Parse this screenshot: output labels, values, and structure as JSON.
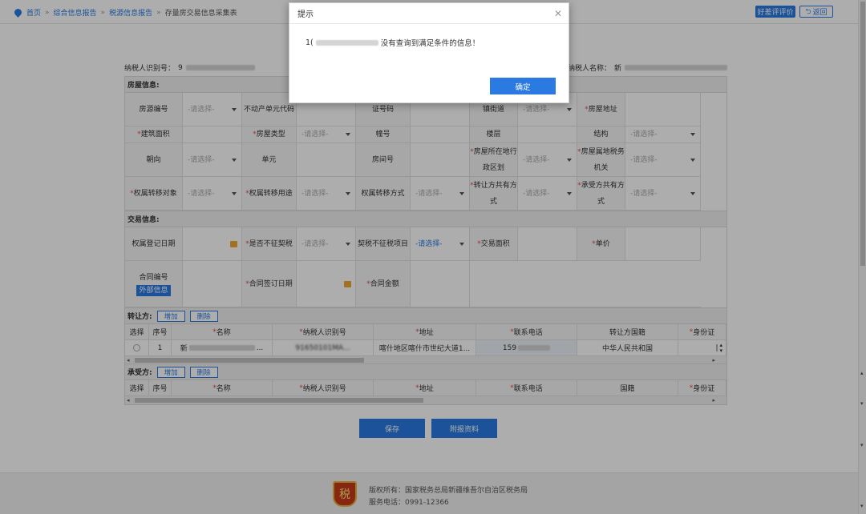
{
  "breadcrumb": [
    "首页",
    "综合信息报告",
    "税源信息报告",
    "存量房交易信息采集表"
  ],
  "top_buttons": {
    "evaluate": "好差评评价",
    "back": "返回"
  },
  "header_ids": {
    "taxpayer_id_label": "纳税人识别号：",
    "taxpayer_id_prefix": "9",
    "taxpayer_name_label": "纳税人名称：",
    "taxpayer_name_prefix": "新"
  },
  "house_section": {
    "title": "房屋信息:",
    "row1": {
      "c0": "房源编号",
      "c1": "-请选择-",
      "c2": "不动产单元代码",
      "c4": "证号码",
      "c6": "镇街道",
      "c7": "-请选择-",
      "c8": "房屋地址"
    },
    "row2": {
      "c0": "建筑面积",
      "c2": "房屋类型",
      "c3": "-请选择-",
      "c4": "幢号",
      "c6": "楼层",
      "c8": "结构",
      "c9": "-请选择-"
    },
    "row3": {
      "c0": "朝向",
      "c1": "-请选择-",
      "c2": "单元",
      "c4": "房间号",
      "c6": "房屋所在地行政区划",
      "c7": "-请选择-",
      "c8": "房屋属地税务机关",
      "c9": "-请选择-"
    },
    "row4": {
      "c0": "权属转移对象",
      "c1": "-请选择-",
      "c2": "权属转移用途",
      "c3": "-请选择-",
      "c4": "权属转移方式",
      "c5": "-请选择-",
      "c6": "转让方共有方式",
      "c7": "-请选择-",
      "c8": "承受方共有方式",
      "c9": "-请选择-"
    }
  },
  "trade_section": {
    "title": "交易信息:",
    "row1": {
      "c0": "权属登记日期",
      "c2": "是否不征契税",
      "c3": "-请选择-",
      "c4": "契税不征税项目",
      "c5": "-请选择-",
      "c6": "交易面积",
      "c8": "单价"
    },
    "row2": {
      "c0": "合同编号",
      "c0_btn": "外部信息",
      "c2": "合同签订日期",
      "c4": "合同金额"
    }
  },
  "transferor": {
    "title": "转让方:",
    "add": "增加",
    "delete": "删除",
    "headers": [
      "选择",
      "序号",
      "名称",
      "纳税人识别号",
      "地址",
      "联系电话",
      "转让方国籍",
      "身份证"
    ],
    "row": {
      "index": "1",
      "name_prefix": "新",
      "name_suffix": "...",
      "taxid": "91650101MA...",
      "address": "喀什地区喀什市世纪大道1...",
      "phone_prefix": "159",
      "nationality": "中华人民共和国",
      "id": "|"
    }
  },
  "transferee": {
    "title": "承受方:",
    "add": "增加",
    "delete": "删除",
    "headers": [
      "选择",
      "序号",
      "名称",
      "纳税人识别号",
      "地址",
      "联系电话",
      "国籍",
      "身份证"
    ]
  },
  "bottom_buttons": {
    "save": "保存",
    "attach": "附报资料"
  },
  "footer": {
    "copyright": "版权所有：国家税务总局新疆维吾尔自治区税务局",
    "hotline": "服务电话：0991-12366"
  },
  "dialog": {
    "title": "提示",
    "msg_prefix": "1(",
    "msg": "没有查询到满足条件的信息！",
    "ok": "确定"
  },
  "colors": {
    "accent": "#2a7ae2",
    "required": "#e64a4a",
    "calendar": "#f0a733"
  }
}
